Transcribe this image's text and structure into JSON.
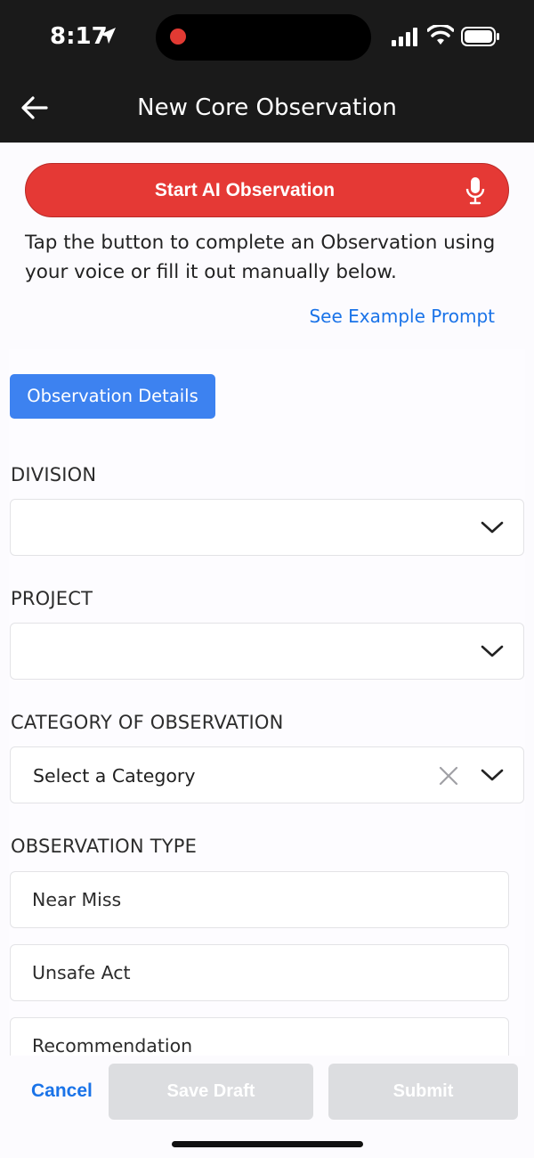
{
  "status_bar": {
    "time": "8:17"
  },
  "header": {
    "title": "New Core Observation"
  },
  "ai_button": {
    "label": "Start AI Observation"
  },
  "intro_text": "Tap the button to complete an Observation using your voice or fill it out manually below.",
  "example_link": "See Example Prompt",
  "section_tab": "Observation Details",
  "fields": {
    "division": {
      "label": "DIVISION",
      "value": ""
    },
    "project": {
      "label": "PROJECT",
      "value": ""
    },
    "category": {
      "label": "CATEGORY OF OBSERVATION",
      "value": "Select a Category"
    },
    "observation_type": {
      "label": "OBSERVATION TYPE",
      "options": [
        "Near Miss",
        "Unsafe Act",
        "Recommendation"
      ]
    }
  },
  "footer": {
    "cancel": "Cancel",
    "save_draft": "Save Draft",
    "submit": "Submit"
  },
  "colors": {
    "accent_red": "#e53935",
    "link_blue": "#1a73e8",
    "tab_blue": "#3d82f0",
    "disabled": "#dcdde0"
  }
}
